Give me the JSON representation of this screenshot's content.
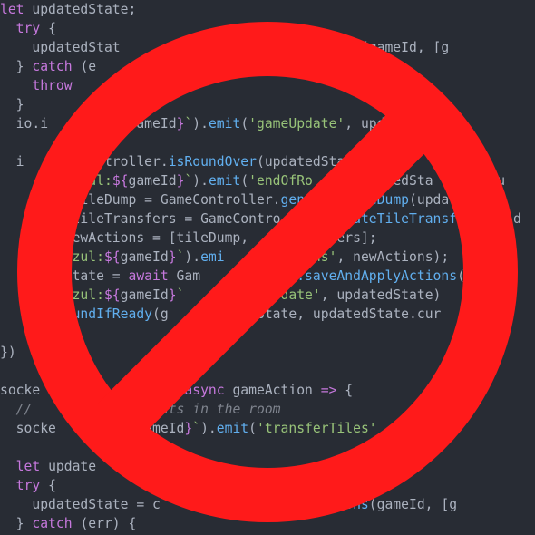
{
  "colors": {
    "background": "#282c34",
    "keyword": "#c678dd",
    "string": "#98c379",
    "function": "#61afef",
    "variable": "#e5c07b",
    "plain": "#abb2bf",
    "comment": "#7f848e",
    "prohibition_sign": "#ff1a1a"
  },
  "icons": {
    "overlay": "prohibition-sign-icon"
  },
  "code_lines": [
    [
      [
        "kw",
        "let "
      ],
      [
        "plain",
        "updatedState;"
      ]
    ],
    [
      [
        "kw",
        "  try "
      ],
      [
        "plain",
        "{"
      ]
    ],
    [
      [
        "plain",
        "    updatedStat"
      ],
      [
        "plain",
        "                        "
      ],
      [
        "fn",
        "ctions"
      ],
      [
        "plain",
        "(gameId, [g"
      ]
    ],
    [
      [
        "plain",
        "  } "
      ],
      [
        "kw",
        "catch "
      ],
      [
        "plain",
        "(e"
      ]
    ],
    [
      [
        "kw",
        "    throw"
      ]
    ],
    [
      [
        "plain",
        "  }"
      ]
    ],
    [
      [
        "plain",
        "  io.i"
      ],
      [
        "plain",
        "           "
      ],
      [
        "plain",
        "ameId"
      ],
      [
        "interp",
        "}"
      ],
      [
        "str",
        "`"
      ],
      [
        "plain",
        ")."
      ],
      [
        "fn",
        "emit"
      ],
      [
        "plain",
        "("
      ],
      [
        "str",
        "'gameUpdate'"
      ],
      [
        "plain",
        ", upda"
      ]
    ],
    [
      [
        "plain",
        ""
      ]
    ],
    [
      [
        "plain",
        "  i"
      ],
      [
        "plain",
        "          "
      ],
      [
        "plain",
        "troller."
      ],
      [
        "fn",
        "isRoundOver"
      ],
      [
        "plain",
        "(updatedStat"
      ]
    ],
    [
      [
        "plain",
        "         "
      ],
      [
        "str",
        "azul:"
      ],
      [
        "interp",
        "${"
      ],
      [
        "plain",
        "gameId"
      ],
      [
        "interp",
        "}"
      ],
      [
        "str",
        "`"
      ],
      [
        "plain",
        ")."
      ],
      [
        "fn",
        "emit"
      ],
      [
        "plain",
        "("
      ],
      [
        "str",
        "'endOfRo"
      ],
      [
        "plain",
        "       "
      ],
      [
        "plain",
        "datedSta"
      ],
      [
        "plain",
        "       "
      ],
      [
        "plain",
        "ou"
      ]
    ],
    [
      [
        "plain",
        "         "
      ],
      [
        "plain",
        "tileDump = GameController."
      ],
      [
        "fn",
        "gen"
      ],
      [
        "plain",
        "       "
      ],
      [
        "fn",
        "teDump"
      ],
      [
        "plain",
        "(update"
      ]
    ],
    [
      [
        "plain",
        "         "
      ],
      [
        "plain",
        "tileTransfers = GameContro"
      ],
      [
        "plain",
        "       "
      ],
      [
        "fn",
        "erateTileTransfe"
      ],
      [
        "plain",
        "      d"
      ]
    ],
    [
      [
        "plain",
        "        newActions = [tileDump,"
      ],
      [
        "plain",
        "      "
      ],
      [
        "plain",
        "ransfers];"
      ]
    ],
    [
      [
        "str",
        "       `azul:"
      ],
      [
        "interp",
        "${"
      ],
      [
        "plain",
        "gameId"
      ],
      [
        "interp",
        "}"
      ],
      [
        "str",
        "`"
      ],
      [
        "plain",
        ")."
      ],
      [
        "fn",
        "emi"
      ],
      [
        "plain",
        "       "
      ],
      [
        "str",
        "ctions'"
      ],
      [
        "plain",
        ", newActions);"
      ]
    ],
    [
      [
        "plain",
        "      edState = "
      ],
      [
        "kw",
        "await "
      ],
      [
        "plain",
        "Gam"
      ],
      [
        "plain",
        "        "
      ],
      [
        "fn",
        "ller.saveAndApplyActions"
      ],
      [
        "plain",
        "("
      ]
    ],
    [
      [
        "str",
        "       `azul:"
      ],
      [
        "interp",
        "${"
      ],
      [
        "plain",
        "gameId"
      ],
      [
        "interp",
        "}"
      ],
      [
        "str",
        "`"
      ],
      [
        "plain",
        "      "
      ],
      [
        "str",
        "gameUpdate'"
      ],
      [
        "plain",
        ", updatedState)"
      ]
    ],
    [
      [
        "plain",
        "       "
      ],
      [
        "fn",
        "roundIfReady"
      ],
      [
        "plain",
        "(g"
      ],
      [
        "plain",
        "     "
      ],
      [
        "plain",
        "pdatedState, updatedState.cur"
      ]
    ],
    [
      [
        "plain",
        ""
      ]
    ],
    [
      [
        "plain",
        "})"
      ]
    ],
    [
      [
        "plain",
        ""
      ]
    ],
    [
      [
        "plain",
        "socke"
      ],
      [
        "plain",
        "           "
      ],
      [
        "str",
        "iles'"
      ],
      [
        "plain",
        ", "
      ],
      [
        "kw",
        "async "
      ],
      [
        "plain",
        "gameAction "
      ],
      [
        "kw",
        "=> "
      ],
      [
        "plain",
        "{"
      ]
    ],
    [
      [
        "comment",
        "  // "
      ],
      [
        "plain",
        "       "
      ],
      [
        "comment",
        "her clients in the room"
      ]
    ],
    [
      [
        "plain",
        "  socke"
      ],
      [
        "plain",
        "          "
      ],
      [
        "plain",
        "gameId"
      ],
      [
        "interp",
        "}"
      ],
      [
        "str",
        "`"
      ],
      [
        "plain",
        ")."
      ],
      [
        "fn",
        "emit"
      ],
      [
        "plain",
        "("
      ],
      [
        "str",
        "'transferTiles'"
      ],
      [
        "plain",
        "         "
      ],
      [
        "plain",
        ";"
      ]
    ],
    [
      [
        "plain",
        ""
      ]
    ],
    [
      [
        "kw",
        "  let "
      ],
      [
        "plain",
        "update"
      ]
    ],
    [
      [
        "kw",
        "  try "
      ],
      [
        "plain",
        "{"
      ]
    ],
    [
      [
        "plain",
        "    updatedState = "
      ],
      [
        "plain",
        "c"
      ],
      [
        "plain",
        "                  "
      ],
      [
        "fn",
        "yActions"
      ],
      [
        "plain",
        "(gameId, [g"
      ]
    ],
    [
      [
        "plain",
        "  } "
      ],
      [
        "kw",
        "catch "
      ],
      [
        "plain",
        "(err) {"
      ]
    ]
  ]
}
